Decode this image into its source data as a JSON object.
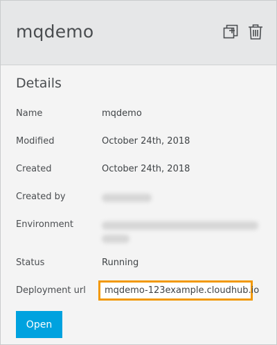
{
  "app": {
    "name": "mqdemo"
  },
  "header": {
    "copy_icon": "copy-add-icon",
    "delete_icon": "trash-icon"
  },
  "details": {
    "title": "Details",
    "rows": [
      {
        "label": "Name",
        "value": "mqdemo"
      },
      {
        "label": "Modified",
        "value": "October 24th, 2018"
      },
      {
        "label": "Created",
        "value": "October 24th, 2018"
      },
      {
        "label": "Created by",
        "value": ""
      },
      {
        "label": "Environment",
        "value": ""
      },
      {
        "label": "Status",
        "value": "Running"
      },
      {
        "label": "Deployment url",
        "value": "mqdemo-123example.cloudhub.io"
      }
    ]
  },
  "actions": {
    "open_label": "Open"
  },
  "colors": {
    "accent": "#00a2df",
    "highlight": "#f29800",
    "header_bg": "#e6e7e8",
    "panel_bg": "#f4f4f4"
  }
}
